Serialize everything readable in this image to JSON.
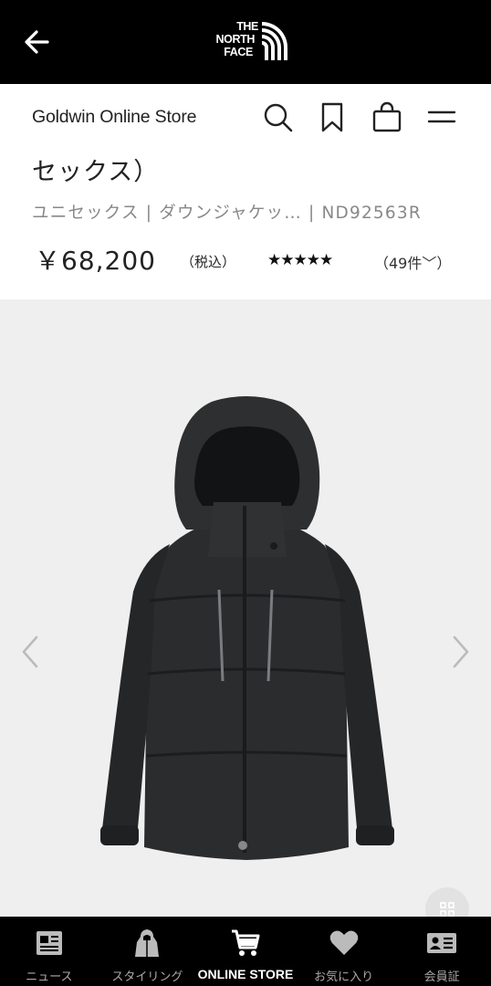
{
  "header": {
    "logo_line1": "THE",
    "logo_line2": "NORTH",
    "logo_line3": "FACE"
  },
  "store": {
    "name": "Goldwin Online Store"
  },
  "product": {
    "title": "セックス）",
    "category": "ユニセックス | ダウンジャケッ…  | ND92563R",
    "price": "￥68,200",
    "tax_label": "（税込）",
    "stars": "★★★★★",
    "rating": 4.5,
    "review_count": "（49件﹀）"
  },
  "colors": {
    "topbar": "#000000",
    "gallery_bg": "#efefef",
    "jacket": "#2b2c2e"
  },
  "bottom_nav": {
    "items": [
      {
        "label": "ニュース",
        "icon": "news-icon"
      },
      {
        "label": "スタイリング",
        "icon": "styling-icon"
      },
      {
        "label": "ONLINE STORE",
        "icon": "cart-icon",
        "active": true
      },
      {
        "label": "お気に入り",
        "icon": "heart-icon"
      },
      {
        "label": "会員証",
        "icon": "member-card-icon"
      }
    ]
  }
}
